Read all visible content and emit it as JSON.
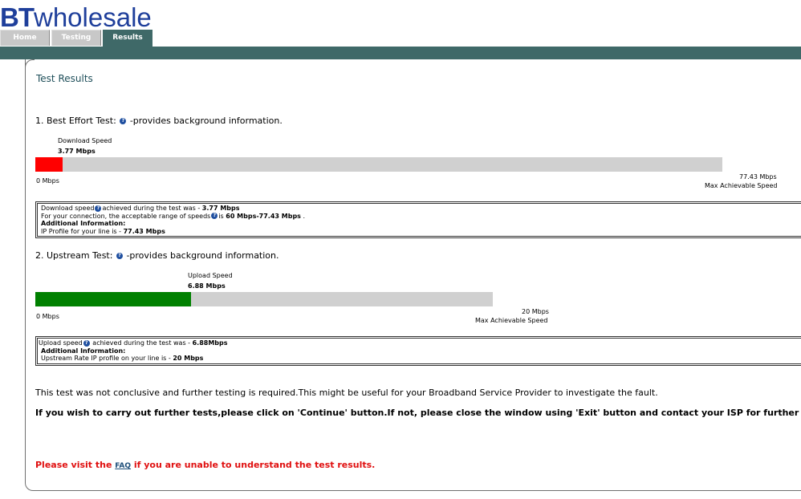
{
  "header": {
    "logo_bt": "BT",
    "logo_word": "wholesale",
    "tabs": [
      {
        "label": "Home"
      },
      {
        "label": "Testing"
      },
      {
        "label": "Results"
      }
    ]
  },
  "page_title": "Test Results",
  "best_effort": {
    "heading": "1. Best Effort Test:",
    "heading_suffix": "-provides background information.",
    "bar_label": "Download Speed",
    "bar_value": "3.77 Mbps",
    "min_label": "0 Mbps",
    "max_value": "77.43 Mbps",
    "max_label": "Max Achievable Speed",
    "fill_fraction": 0.04,
    "fill_color": "#ff0000",
    "info": {
      "line1_a": "Download speed",
      "line1_b": "achieved during the test was - ",
      "line1_value": "3.77 Mbps",
      "line2_a": "For your connection, the acceptable range of speeds",
      "line2_b": "is ",
      "line2_value": "60 Mbps-77.43 Mbps",
      "line2_end": " .",
      "line3": "Additional Information:",
      "line4_a": "IP Profile for your line is - ",
      "line4_value": "77.43 Mbps"
    }
  },
  "upstream": {
    "heading": "2. Upstream Test:",
    "heading_suffix": "-provides background information.",
    "bar_label": "Upload Speed",
    "bar_value": "6.88 Mbps",
    "min_label": "0 Mbps",
    "max_value": "20 Mbps",
    "max_label": "Max Achievable Speed",
    "fill_fraction": 0.34,
    "fill_color": "#008000",
    "info": {
      "line1_a": "Upload speed",
      "line1_b": " achieved during the test was - ",
      "line1_value": "6.88Mbps",
      "line2": "Additional Information:",
      "line3_a": "Upstream Rate IP profile on your line is - ",
      "line3_value": "20 Mbps"
    }
  },
  "conclusion": "This test was not conclusive and further testing is required.This might be useful for your Broadband Service Provider to investigate the fault.",
  "instruction": "If you wish to carry out further tests,please click on 'Continue' button.If not, please close the window using 'Exit' button and contact your ISP for further as",
  "faq_line": {
    "before": "Please visit the ",
    "link": "FAQ",
    "after": " if you are unable to understand the test results."
  }
}
